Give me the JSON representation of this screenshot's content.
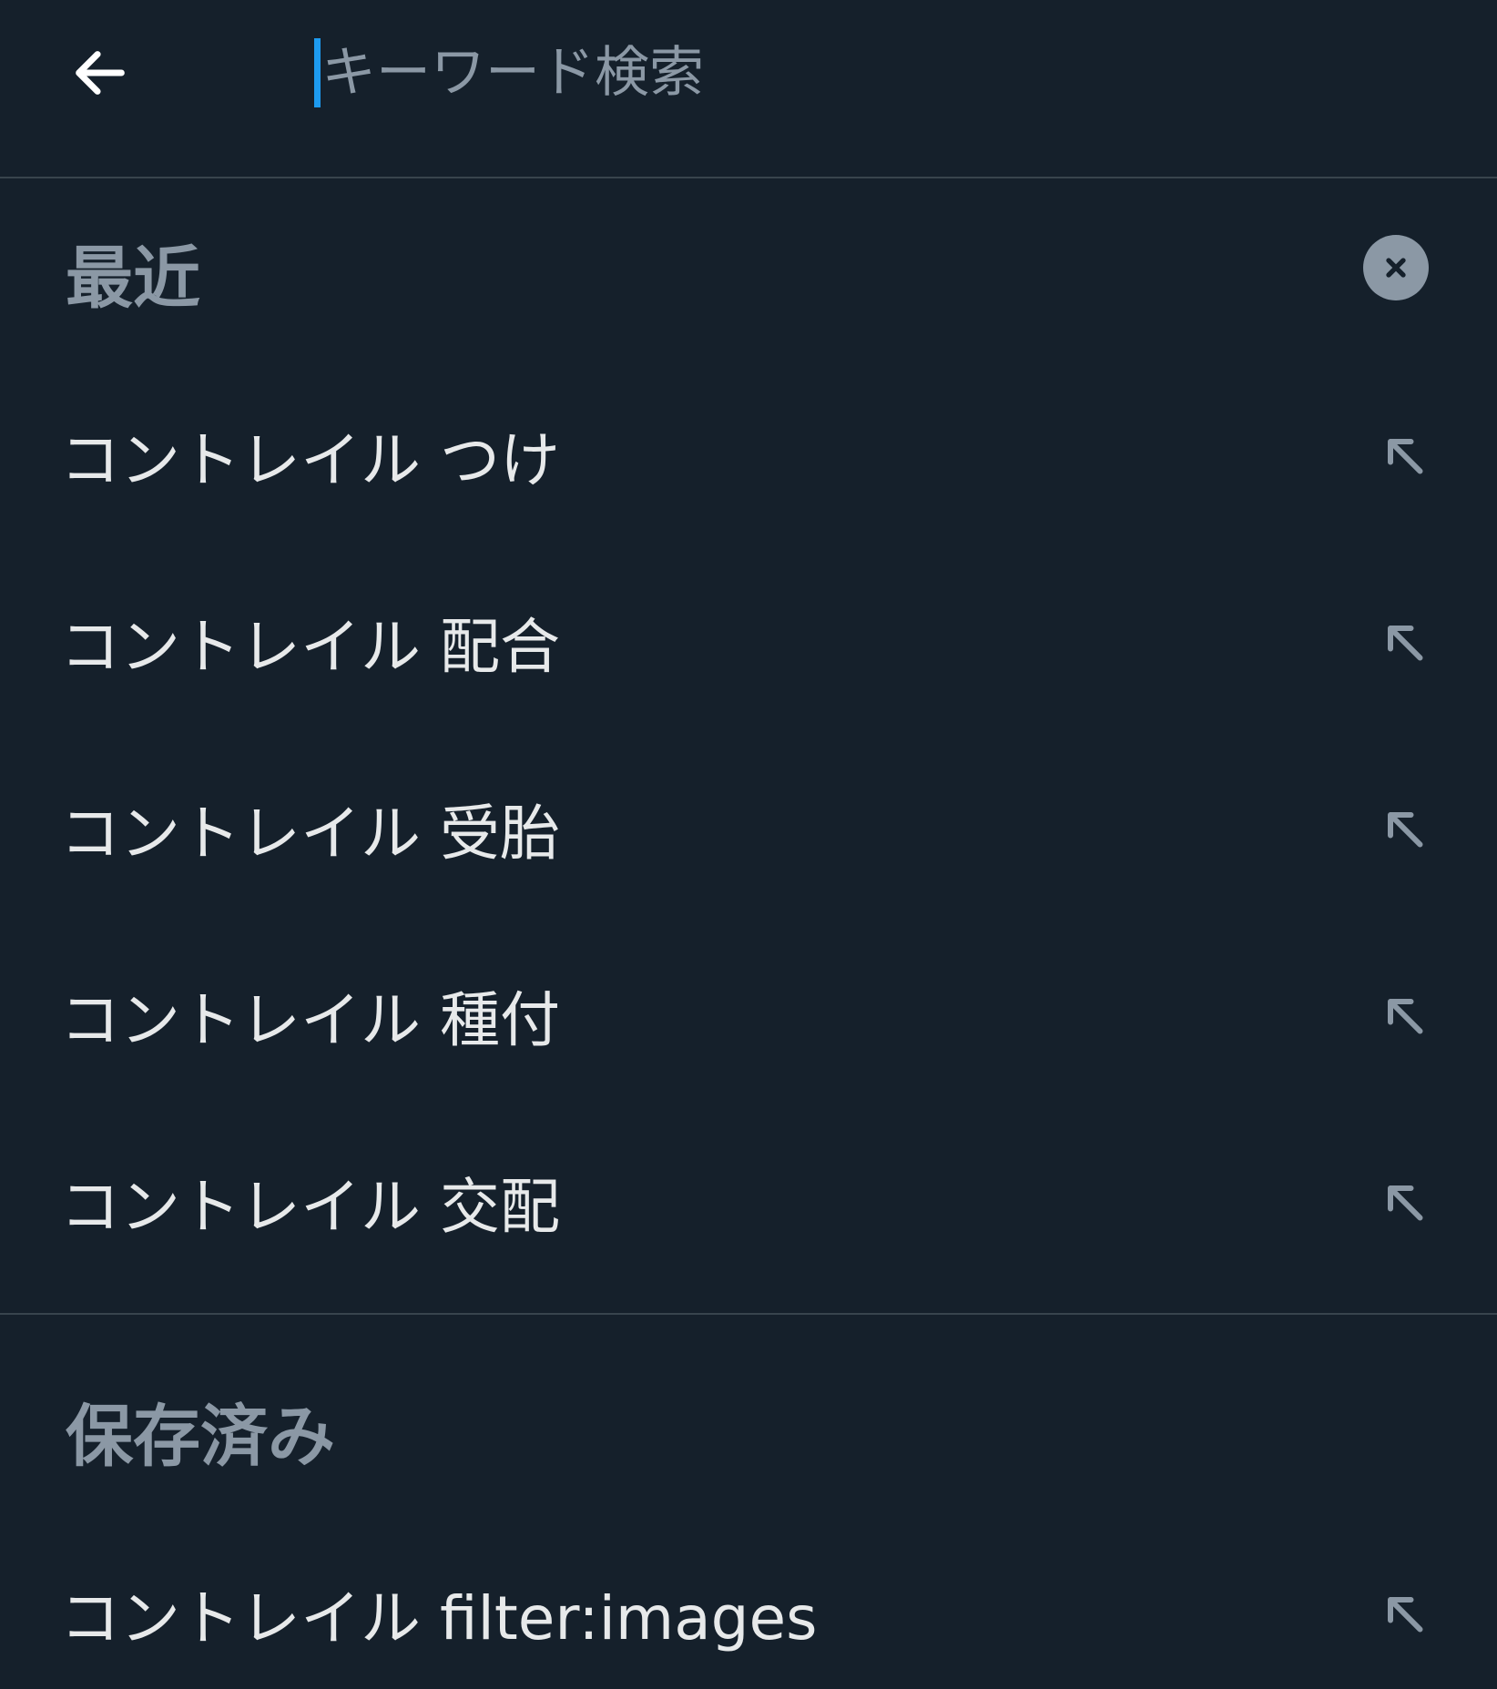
{
  "search": {
    "placeholder": "キーワード検索",
    "value": ""
  },
  "recent": {
    "heading": "最近",
    "clear_icon": "close-icon",
    "items": [
      {
        "label": "コントレイル つけ",
        "icon": "arrow-up-left-icon"
      },
      {
        "label": "コントレイル 配合",
        "icon": "arrow-up-left-icon"
      },
      {
        "label": "コントレイル 受胎",
        "icon": "arrow-up-left-icon"
      },
      {
        "label": "コントレイル 種付",
        "icon": "arrow-up-left-icon"
      },
      {
        "label": "コントレイル 交配",
        "icon": "arrow-up-left-icon"
      }
    ]
  },
  "saved": {
    "heading": "保存済み",
    "items": [
      {
        "label": "コントレイル filter:images",
        "icon": "arrow-up-left-icon"
      }
    ]
  },
  "colors": {
    "background": "#15202b",
    "accent": "#1d9bf0",
    "muted": "#8b98a5",
    "divider": "#38444d"
  }
}
